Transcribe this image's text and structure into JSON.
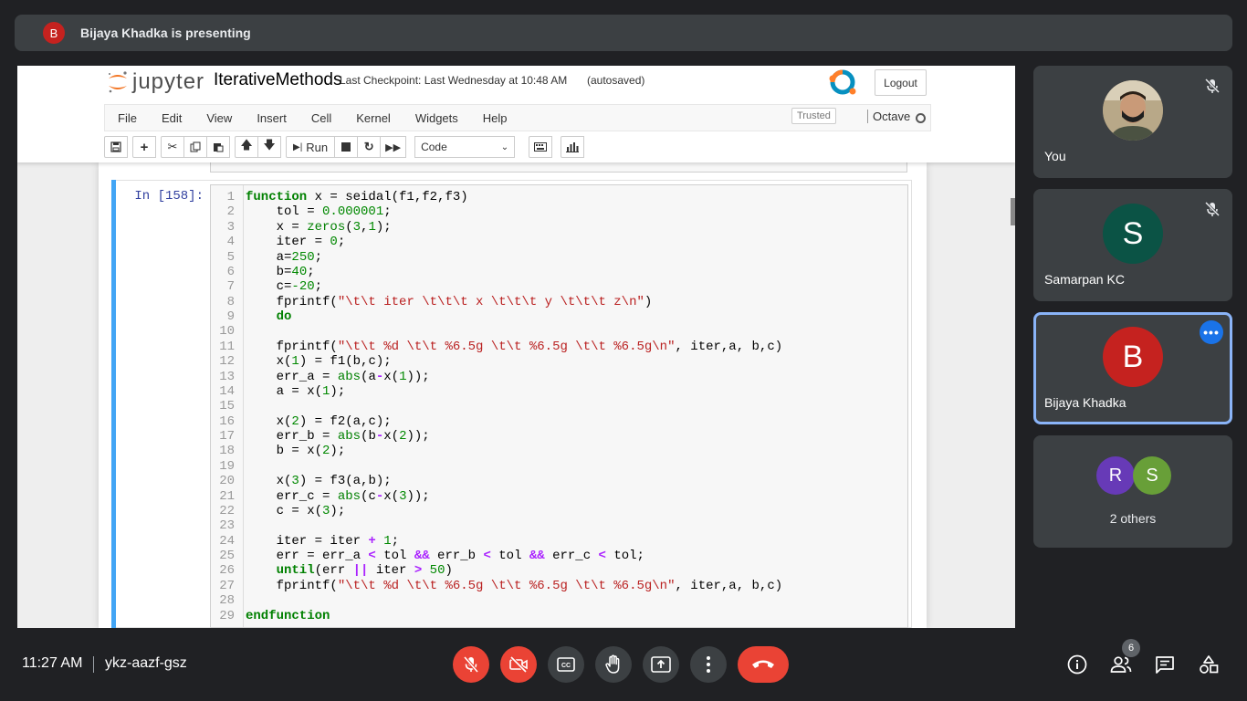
{
  "presenting": {
    "avatar_letter": "B",
    "text": "Bijaya Khadka is presenting"
  },
  "jupyter": {
    "logo_text": "jupyter",
    "notebook_name": "IterativeMethods",
    "checkpoint": "Last Checkpoint: Last Wednesday at 10:48 AM",
    "autosaved": "(autosaved)",
    "logout_label": "Logout",
    "menu": [
      "File",
      "Edit",
      "View",
      "Insert",
      "Cell",
      "Kernel",
      "Widgets",
      "Help"
    ],
    "trusted": "Trusted",
    "kernel_name": "Octave",
    "toolbar": {
      "run_label": "Run",
      "cell_type": "Code"
    },
    "cell": {
      "prompt": "In [158]:",
      "lines": [
        {
          "n": "1",
          "segs": [
            [
              "kw-plain",
              "function x = seidal(f1,f2,f3)"
            ]
          ]
        },
        {
          "n": "2",
          "segs": [
            [
              "",
              "    tol = "
            ],
            [
              "num",
              "0.000001"
            ],
            [
              "",
              ";"
            ]
          ]
        },
        {
          "n": "3",
          "segs": [
            [
              "",
              "    x = "
            ],
            [
              "blt",
              "zeros"
            ],
            [
              "",
              "("
            ],
            [
              "num",
              "3"
            ],
            [
              "",
              ","
            ],
            [
              "num",
              "1"
            ],
            [
              "",
              ");"
            ]
          ]
        },
        {
          "n": "4",
          "segs": [
            [
              "",
              "    iter = "
            ],
            [
              "num",
              "0"
            ],
            [
              "",
              ";"
            ]
          ]
        },
        {
          "n": "5",
          "segs": [
            [
              "",
              "    a="
            ],
            [
              "num",
              "250"
            ],
            [
              "",
              ";"
            ]
          ]
        },
        {
          "n": "6",
          "segs": [
            [
              "",
              "    b="
            ],
            [
              "num",
              "40"
            ],
            [
              "",
              ";"
            ]
          ]
        },
        {
          "n": "7",
          "segs": [
            [
              "",
              "    c="
            ],
            [
              "num",
              "-20"
            ],
            [
              "",
              ";"
            ]
          ]
        },
        {
          "n": "8",
          "segs": [
            [
              "",
              "    fprintf("
            ],
            [
              "str",
              "\"\\t\\t iter \\t\\t\\t x \\t\\t\\t y \\t\\t\\t z\\n\""
            ],
            [
              "",
              ")"
            ]
          ]
        },
        {
          "n": "9",
          "segs": [
            [
              "kw",
              "    do"
            ]
          ]
        },
        {
          "n": "10",
          "segs": [
            [
              "",
              ""
            ]
          ]
        },
        {
          "n": "11",
          "segs": [
            [
              "",
              "    fprintf("
            ],
            [
              "str",
              "\"\\t\\t %d \\t\\t %6.5g \\t\\t %6.5g \\t\\t %6.5g\\n\""
            ],
            [
              "",
              ", iter,a, b,c)"
            ]
          ]
        },
        {
          "n": "12",
          "segs": [
            [
              "",
              "    x("
            ],
            [
              "num",
              "1"
            ],
            [
              "",
              ") = f1(b,c);"
            ]
          ]
        },
        {
          "n": "13",
          "segs": [
            [
              "",
              "    err_a = "
            ],
            [
              "blt",
              "abs"
            ],
            [
              "",
              "(a"
            ],
            [
              "op",
              "-"
            ],
            [
              "",
              "x("
            ],
            [
              "num",
              "1"
            ],
            [
              "",
              "));"
            ]
          ]
        },
        {
          "n": "14",
          "segs": [
            [
              "",
              "    a = x("
            ],
            [
              "num",
              "1"
            ],
            [
              "",
              ");"
            ]
          ]
        },
        {
          "n": "15",
          "segs": [
            [
              "",
              ""
            ]
          ]
        },
        {
          "n": "16",
          "segs": [
            [
              "",
              "    x("
            ],
            [
              "num",
              "2"
            ],
            [
              "",
              ") = f2(a,c);"
            ]
          ]
        },
        {
          "n": "17",
          "segs": [
            [
              "",
              "    err_b = "
            ],
            [
              "blt",
              "abs"
            ],
            [
              "",
              "(b"
            ],
            [
              "op",
              "-"
            ],
            [
              "",
              "x("
            ],
            [
              "num",
              "2"
            ],
            [
              "",
              "));"
            ]
          ]
        },
        {
          "n": "18",
          "segs": [
            [
              "",
              "    b = x("
            ],
            [
              "num",
              "2"
            ],
            [
              "",
              ");"
            ]
          ]
        },
        {
          "n": "19",
          "segs": [
            [
              "",
              ""
            ]
          ]
        },
        {
          "n": "20",
          "segs": [
            [
              "",
              "    x("
            ],
            [
              "num",
              "3"
            ],
            [
              "",
              ") = f3(a,b);"
            ]
          ]
        },
        {
          "n": "21",
          "segs": [
            [
              "",
              "    err_c = "
            ],
            [
              "blt",
              "abs"
            ],
            [
              "",
              "(c"
            ],
            [
              "op",
              "-"
            ],
            [
              "",
              "x("
            ],
            [
              "num",
              "3"
            ],
            [
              "",
              "));"
            ]
          ]
        },
        {
          "n": "22",
          "segs": [
            [
              "",
              "    c = x("
            ],
            [
              "num",
              "3"
            ],
            [
              "",
              ");"
            ]
          ]
        },
        {
          "n": "23",
          "segs": [
            [
              "",
              ""
            ]
          ]
        },
        {
          "n": "24",
          "segs": [
            [
              "",
              "    iter = iter "
            ],
            [
              "op",
              "+"
            ],
            [
              "num",
              " 1"
            ],
            [
              "",
              ";"
            ]
          ]
        },
        {
          "n": "25",
          "segs": [
            [
              "",
              "    err = err_a "
            ],
            [
              "op",
              "<"
            ],
            [
              "",
              " tol "
            ],
            [
              "op",
              "&&"
            ],
            [
              "",
              " err_b "
            ],
            [
              "op",
              "<"
            ],
            [
              "",
              " tol "
            ],
            [
              "op",
              "&&"
            ],
            [
              "",
              " err_c "
            ],
            [
              "op",
              "<"
            ],
            [
              "",
              " tol;"
            ]
          ]
        },
        {
          "n": "26",
          "segs": [
            [
              "kw",
              "    until"
            ],
            [
              "",
              "(err "
            ],
            [
              "op",
              "||"
            ],
            [
              "",
              " iter "
            ],
            [
              "op",
              ">"
            ],
            [
              "num",
              " 50"
            ],
            [
              "",
              ")"
            ]
          ]
        },
        {
          "n": "27",
          "segs": [
            [
              "",
              "    fprintf("
            ],
            [
              "str",
              "\"\\t\\t %d \\t\\t %6.5g \\t\\t %6.5g \\t\\t %6.5g\\n\""
            ],
            [
              "",
              ", iter,a, b,c)"
            ]
          ]
        },
        {
          "n": "28",
          "segs": [
            [
              "",
              ""
            ]
          ]
        },
        {
          "n": "29",
          "segs": [
            [
              "kw",
              "endfunction"
            ]
          ]
        }
      ]
    }
  },
  "participants": [
    {
      "name": "You",
      "muted": true
    },
    {
      "name": "Samarpan KC",
      "avatar_letter": "S",
      "avatar_color": "#0b5345",
      "muted": true
    },
    {
      "name": "Bijaya Khadka",
      "avatar_letter": "B",
      "avatar_color": "#c5221f",
      "active": true
    }
  ],
  "others": {
    "letters": [
      "R",
      "S"
    ],
    "colors": [
      "#673ab7",
      "#689f38"
    ],
    "label": "2 others"
  },
  "bottom_bar": {
    "time": "11:27 AM",
    "meeting_code": "ykz-aazf-gsz",
    "participant_count": "6"
  },
  "colors": {
    "accent": "#8ab4f8",
    "danger": "#ea4335",
    "tile_bg": "#3c4043"
  }
}
